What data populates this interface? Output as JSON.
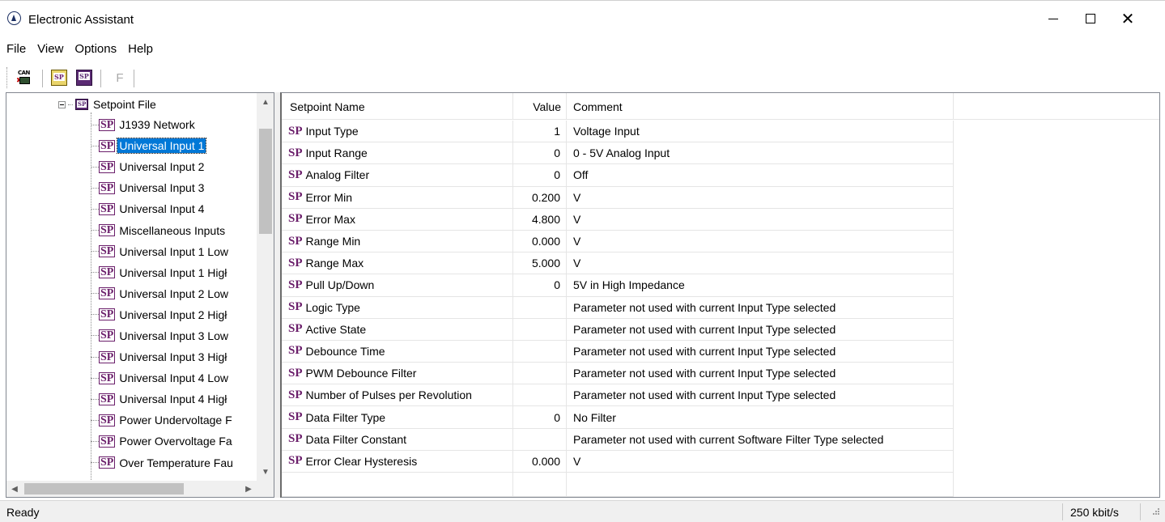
{
  "window": {
    "title": "Electronic Assistant",
    "controls": {
      "minimize": "—",
      "maximize": "☐",
      "close": "✕"
    }
  },
  "menu": [
    "File",
    "View",
    "Options",
    "Help"
  ],
  "toolbar": {
    "can_icon_text": "CAN",
    "sp_text": "SP",
    "f_label": "F"
  },
  "tree": {
    "root_label": "Setpoint File",
    "root_icon_text": "SP",
    "badge": "SP",
    "items": [
      {
        "label": "J1939 Network"
      },
      {
        "label": "Universal Input 1",
        "selected": true
      },
      {
        "label": "Universal Input 2"
      },
      {
        "label": "Universal Input 3"
      },
      {
        "label": "Universal Input 4"
      },
      {
        "label": "Miscellaneous Inputs"
      },
      {
        "label": "Universal Input 1 Low"
      },
      {
        "label": "Universal Input 1 Higł"
      },
      {
        "label": "Universal Input 2 Low"
      },
      {
        "label": "Universal Input 2 Higł"
      },
      {
        "label": "Universal Input 3 Low"
      },
      {
        "label": "Universal Input 3 Higł"
      },
      {
        "label": "Universal Input 4 Low"
      },
      {
        "label": "Universal Input 4 Higł"
      },
      {
        "label": "Power Undervoltage F"
      },
      {
        "label": "Power Overvoltage Fa"
      },
      {
        "label": "Over Temperature Fau"
      }
    ],
    "scroll_up": "^",
    "scroll_down": "v",
    "scroll_left": "<",
    "scroll_right": ">"
  },
  "grid": {
    "columns": [
      "Setpoint Name",
      "Value",
      "Comment"
    ],
    "prefix": "SP",
    "rows": [
      {
        "name": "Input Type",
        "value": "1",
        "comment": "Voltage Input"
      },
      {
        "name": "Input Range",
        "value": "0",
        "comment": "0 - 5V Analog Input"
      },
      {
        "name": "Analog Filter",
        "value": "0",
        "comment": "Off"
      },
      {
        "name": "Error Min",
        "value": "0.200",
        "comment": "V"
      },
      {
        "name": "Error Max",
        "value": "4.800",
        "comment": "V"
      },
      {
        "name": "Range Min",
        "value": "0.000",
        "comment": "V"
      },
      {
        "name": "Range Max",
        "value": "5.000",
        "comment": "V"
      },
      {
        "name": "Pull Up/Down",
        "value": "0",
        "comment": "5V in High Impedance"
      },
      {
        "name": "Logic Type",
        "value": "",
        "comment": "Parameter not used with current Input Type selected"
      },
      {
        "name": "Active State",
        "value": "",
        "comment": "Parameter not used with current Input Type selected"
      },
      {
        "name": "Debounce Time",
        "value": "",
        "comment": "Parameter not used with current Input Type selected"
      },
      {
        "name": "PWM Debounce Filter",
        "value": "",
        "comment": "Parameter not used with current Input Type selected"
      },
      {
        "name": "Number of Pulses per Revolution",
        "value": "",
        "comment": "Parameter not used with current Input Type selected"
      },
      {
        "name": "Data Filter Type",
        "value": "0",
        "comment": "No Filter"
      },
      {
        "name": "Data Filter Constant",
        "value": "",
        "comment": "Parameter not used with current Software Filter Type selected"
      },
      {
        "name": "Error Clear Hysteresis",
        "value": "0.000",
        "comment": "V"
      }
    ]
  },
  "status": {
    "left": "Ready",
    "right": "250 kbit/s"
  },
  "colors": {
    "selection": "#0078d7",
    "sp_purple": "#6b1f6b"
  }
}
